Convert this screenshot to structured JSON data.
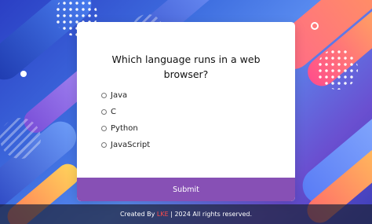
{
  "quiz": {
    "question": "Which language runs in a web browser?",
    "options": [
      "Java",
      "C",
      "Python",
      "JavaScript"
    ],
    "submit_label": "Submit"
  },
  "footer": {
    "prefix": "Created By ",
    "brand": "LKE",
    "suffix": " | 2024 All rights reserved."
  },
  "colors": {
    "submit_bg": "#8750b5",
    "brand": "#ff4b4b"
  }
}
